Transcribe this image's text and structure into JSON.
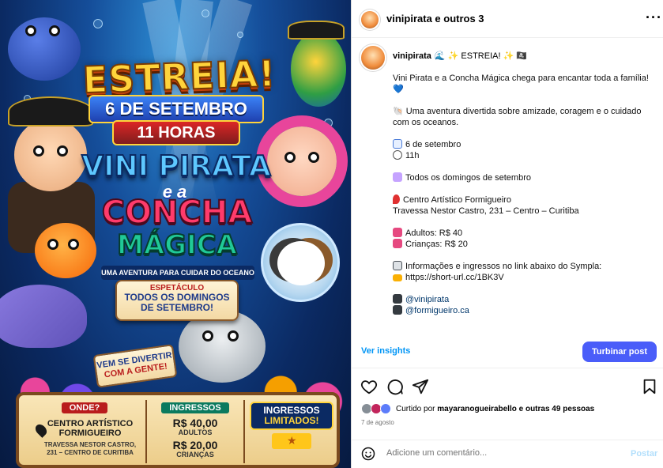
{
  "poster": {
    "headline": "ESTREIA!",
    "date_banner": "6 DE SETEMBRO",
    "time_banner": "11 HORAS",
    "title_line1": "VINI PIRATA",
    "title_connector": "e a",
    "title_line2": "CONCHA",
    "title_line3": "MÁGICA",
    "subtitle": "UMA AVENTURA PARA CUIDAR DO OCEANO",
    "scroll_line1": "ESPETÁCULO",
    "scroll_line2": "TODOS OS DOMINGOS",
    "scroll_line3": "DE SETEMBRO!",
    "fun_line1": "VEM SE DIVERTIR",
    "fun_line2": "COM A GENTE!",
    "where_header": "ONDE?",
    "venue_name_1": "CENTRO ARTÍSTICO",
    "venue_name_2": "FORMIGUEIRO",
    "venue_addr_1": "TRAVESSA NESTOR CASTRO,",
    "venue_addr_2": "231 – CENTRO DE CURITIBA",
    "tickets_header": "INGRESSOS",
    "price_adult": "R$ 40,00",
    "price_adult_label": "ADULTOS",
    "price_child": "R$ 20,00",
    "price_child_label": "CRIANÇAS",
    "limited_line1": "INGRESSOS",
    "limited_line2": "LIMITADOS!"
  },
  "header": {
    "account": "vinipirata e outros 3",
    "more_icon": "more-horizontal-icon"
  },
  "caption": {
    "username": "vinipirata",
    "head_text": "🌊 ✨ ESTREIA! ✨ 🏴‍☠️",
    "line_intro": "Vini Pirata e a Concha Mágica chega para encantar toda a família! 💙",
    "line_about": "🐚 Uma aventura divertida sobre amizade, coragem e o cuidado com os oceanos.",
    "line_date": "6 de setembro",
    "line_time": "11h",
    "line_sundays": "Todos os domingos de setembro",
    "line_venue": "Centro Artístico Formigueiro",
    "line_address": "Travessa Nestor Castro, 231 – Centro – Curitiba",
    "line_adults": "Adultos: R$ 40",
    "line_children": "Crianças: R$ 20",
    "line_info": "Informações e ingressos no link abaixo do Sympla:",
    "line_link": "https://short-url.cc/1BK3V",
    "handle_1": "@vinipirata",
    "handle_2": "@formigueiro.ca"
  },
  "insights": {
    "link_label": "Ver insights",
    "boost_label": "Turbinar post"
  },
  "actions": {
    "like_icon": "heart-icon",
    "comment_icon": "comment-icon",
    "share_icon": "share-icon",
    "save_icon": "bookmark-icon"
  },
  "likes": {
    "prefix": "Curtido por",
    "user": "mayaranogueirabello",
    "suffix": "e outras 49 pessoas"
  },
  "post_date": "7 de agosto",
  "comment": {
    "placeholder": "Adicione um comentário...",
    "post_label": "Postar"
  },
  "colors": {
    "accent_blue": "#0095f6",
    "boost_button": "#4a5df9",
    "link_dark": "#00376b"
  }
}
